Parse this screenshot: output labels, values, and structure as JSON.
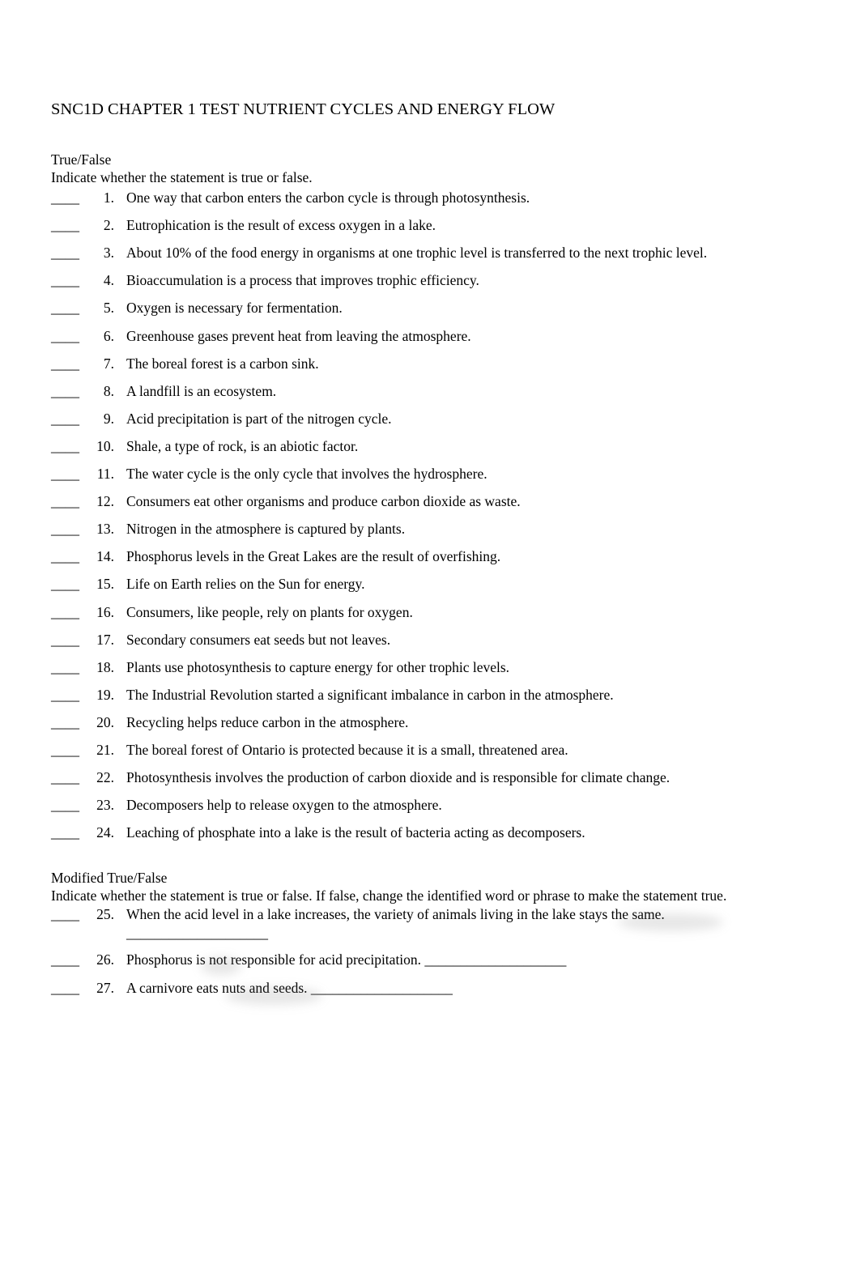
{
  "document": {
    "title": "SNC1D CHAPTER 1 TEST NUTRIENT CYCLES AND ENERGY FLOW",
    "sections": [
      {
        "heading": "True/False",
        "instructions": "Indicate whether the statement is true or false.",
        "questions": [
          {
            "blank": "____",
            "number": "1.",
            "text": "One way that carbon enters the carbon cycle is through photosynthesis."
          },
          {
            "blank": "____",
            "number": "2.",
            "text": "Eutrophication is the result of excess oxygen in a lake."
          },
          {
            "blank": "____",
            "number": "3.",
            "text": "About 10% of the food energy in organisms at one trophic level is transferred to the next trophic level."
          },
          {
            "blank": "____",
            "number": "4.",
            "text": "Bioaccumulation is a process that improves trophic efficiency."
          },
          {
            "blank": "____",
            "number": "5.",
            "text": "Oxygen is necessary for fermentation."
          },
          {
            "blank": "____",
            "number": "6.",
            "text": "Greenhouse gases prevent heat from leaving the atmosphere."
          },
          {
            "blank": "____",
            "number": "7.",
            "text": "The boreal forest is a carbon sink."
          },
          {
            "blank": "____",
            "number": "8.",
            "text": "A landfill is an ecosystem."
          },
          {
            "blank": "____",
            "number": "9.",
            "text": "Acid precipitation is part of the nitrogen cycle."
          },
          {
            "blank": "____",
            "number": "10.",
            "text": "Shale, a type of rock, is an abiotic factor."
          },
          {
            "blank": "____",
            "number": "11.",
            "text": "The water cycle is the only cycle that involves the hydrosphere."
          },
          {
            "blank": "____",
            "number": "12.",
            "text": "Consumers eat other organisms and produce carbon dioxide as waste."
          },
          {
            "blank": "____",
            "number": "13.",
            "text": "Nitrogen in the atmosphere is captured by plants."
          },
          {
            "blank": "____",
            "number": "14.",
            "text": "Phosphorus levels in the Great Lakes are the result of overfishing."
          },
          {
            "blank": "____",
            "number": "15.",
            "text": "Life on Earth relies on the Sun for energy."
          },
          {
            "blank": "____",
            "number": "16.",
            "text": "Consumers, like people, rely on plants for oxygen."
          },
          {
            "blank": "____",
            "number": "17.",
            "text": "Secondary consumers eat seeds but not leaves."
          },
          {
            "blank": "____",
            "number": "18.",
            "text": "Plants use photosynthesis to capture energy for other trophic levels."
          },
          {
            "blank": "____",
            "number": "19.",
            "text": "The Industrial Revolution started a significant imbalance in carbon in the atmosphere."
          },
          {
            "blank": "____",
            "number": "20.",
            "text": "Recycling helps reduce carbon in the atmosphere."
          },
          {
            "blank": "____",
            "number": "21.",
            "text": "The boreal forest of Ontario is protected because it is a small, threatened area."
          },
          {
            "blank": "____",
            "number": "22.",
            "text": "Photosynthesis involves the production of carbon dioxide and is responsible for climate change."
          },
          {
            "blank": "____",
            "number": "23.",
            "text": "Decomposers help to release oxygen to the atmosphere."
          },
          {
            "blank": "____",
            "number": "24.",
            "text": "Leaching of phosphate into a lake is the result of bacteria acting as decomposers."
          }
        ]
      },
      {
        "heading": "Modified True/False",
        "instructions": "Indicate whether the statement is true or false. If false, change the identified word or phrase to make the statement true.",
        "questions": [
          {
            "blank": "____",
            "number": "25.",
            "text": "When the acid level in a lake increases, the variety of animals living in the lake stays the same.",
            "identified": "stays the same",
            "answer_line": "____________________"
          },
          {
            "blank": "____",
            "number": "26.",
            "text": "Phosphorus is not responsible for acid precipitation.",
            "identified": "not",
            "answer_line": "____________________"
          },
          {
            "blank": "____",
            "number": "27.",
            "text": "A carnivore eats nuts and seeds.",
            "identified": "nuts and seeds",
            "answer_line": "____________________"
          }
        ]
      }
    ]
  }
}
